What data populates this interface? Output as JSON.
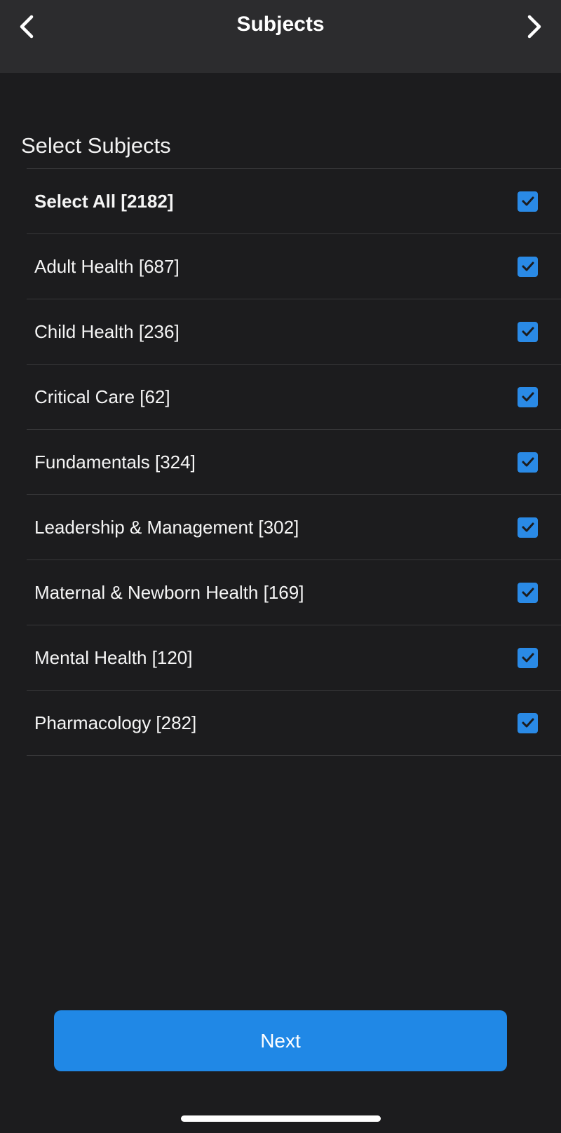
{
  "header": {
    "title": "Subjects",
    "back_icon": "chevron-left-icon",
    "forward_icon": "chevron-right-icon"
  },
  "section_title": "Select Subjects",
  "select_all": {
    "label": "Select All [2182]",
    "checked": true
  },
  "subjects": [
    {
      "label": "Adult Health [687]",
      "checked": true
    },
    {
      "label": "Child Health [236]",
      "checked": true
    },
    {
      "label": "Critical Care [62]",
      "checked": true
    },
    {
      "label": "Fundamentals [324]",
      "checked": true
    },
    {
      "label": "Leadership & Management [302]",
      "checked": true
    },
    {
      "label": "Maternal & Newborn Health [169]",
      "checked": true
    },
    {
      "label": "Mental Health [120]",
      "checked": true
    },
    {
      "label": "Pharmacology [282]",
      "checked": true
    }
  ],
  "next_button": {
    "label": "Next"
  },
  "colors": {
    "background": "#1c1c1e",
    "header_background": "#2c2c2e",
    "accent": "#2088e6",
    "divider": "#38383a"
  }
}
